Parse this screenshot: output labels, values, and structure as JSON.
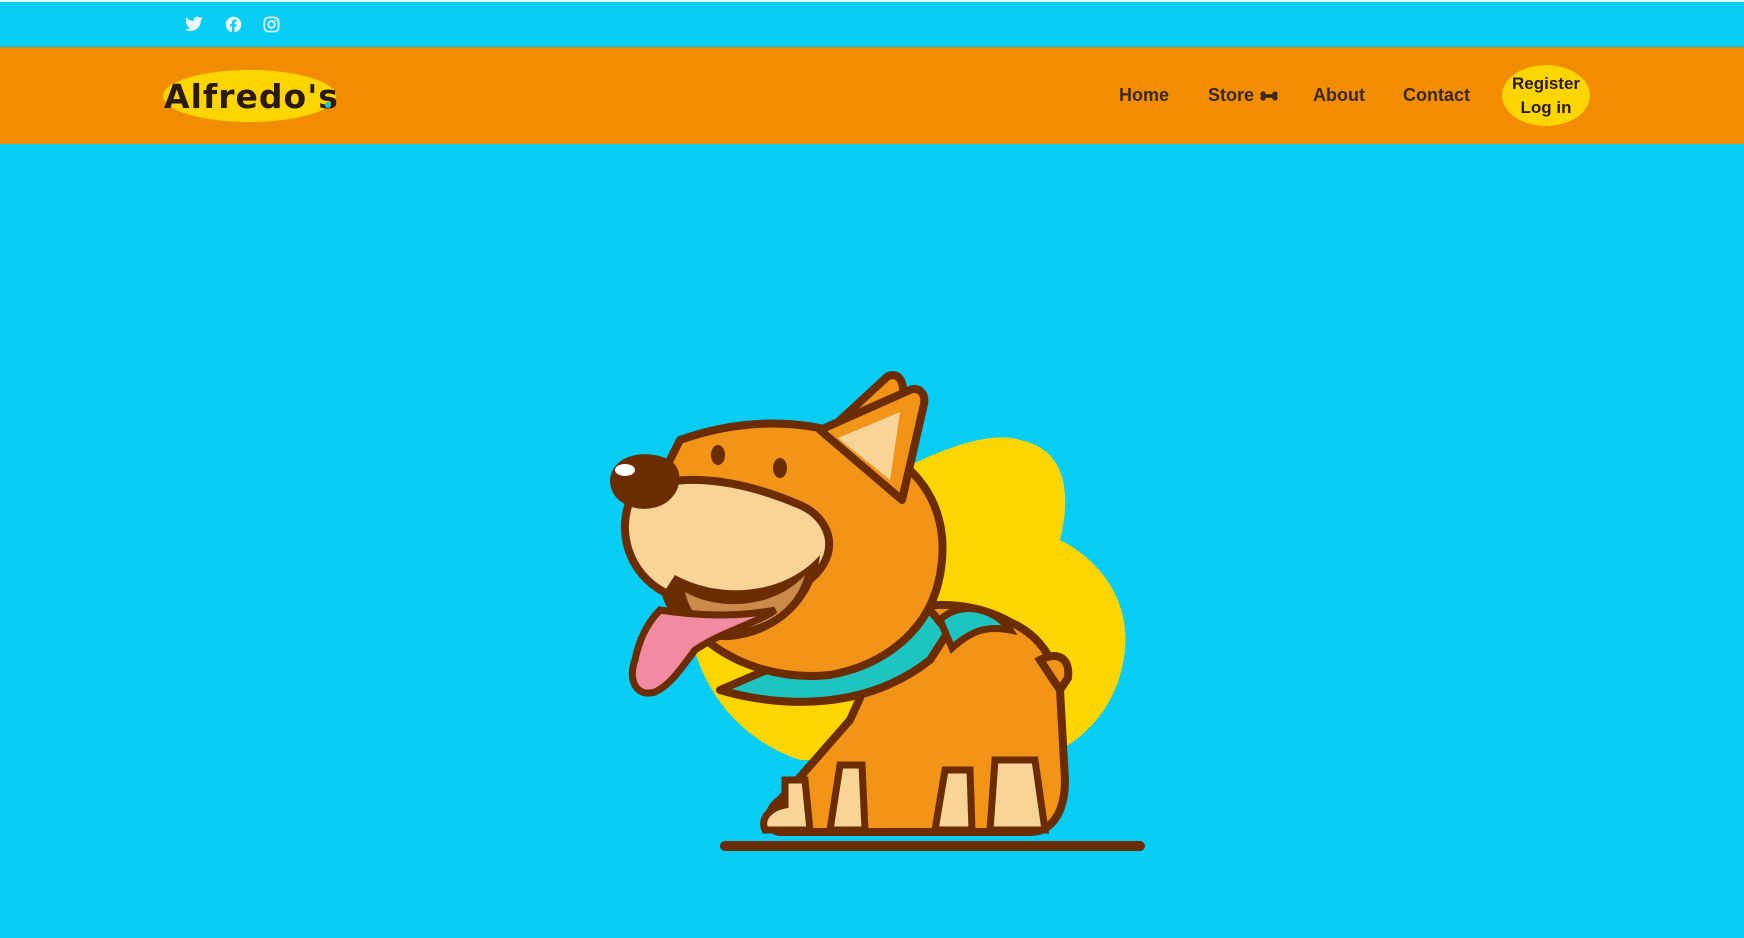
{
  "social": {
    "icons": [
      "twitter-icon",
      "facebook-icon",
      "instagram-icon"
    ]
  },
  "brand": {
    "name": "Alfredo's"
  },
  "nav": {
    "home": "Home",
    "store": "Store",
    "store_icon": "bone-icon",
    "about": "About",
    "contact": "Contact",
    "register": "Register",
    "login": "Log in"
  },
  "colors": {
    "background": "#06cdf4",
    "navbar": "#f28c00",
    "accent_yellow": "#fdd600",
    "text_dark": "#3a2a15"
  }
}
